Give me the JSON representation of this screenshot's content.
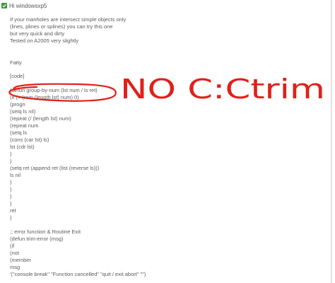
{
  "header": {
    "icon": "check-square-icon",
    "icon_color": "#3c9a3c",
    "text": "Hi windowsxp5"
  },
  "post_lines": [
    "If your manholes are intersect simple objects only",
    "(lines, plines or splines) you can try this one",
    "but very quick and dirty",
    "Tested on A2005 very slightly",
    "Fatty",
    "[code]",
    "(defun group-by-num (lst num / ls ret)",
    "(if (= (rem (length lst) num) 0)",
    "(progn",
    "(setq ls nil)",
    "(repeat (/ (length lst) num)",
    "(repeat num",
    "(setq ls",
    "(cons (car lst) ls)",
    "lst (cdr lst)",
    ")",
    ")",
    "(setq ret (append ret (list (reverse ls)))",
    "ls nil",
    ")",
    ")",
    ")",
    ")",
    "ret",
    ")",
    ";; error function & Routine Exit",
    "(defun trim-error (msg)",
    "(if",
    "(not",
    "(member",
    "msg",
    "'(\"console break\" \"Function cancelled\" \"quit / exit abort\" \"\")"
  ],
  "annotation": {
    "text": "NO C:Ctrim",
    "color": "#e0201a"
  }
}
